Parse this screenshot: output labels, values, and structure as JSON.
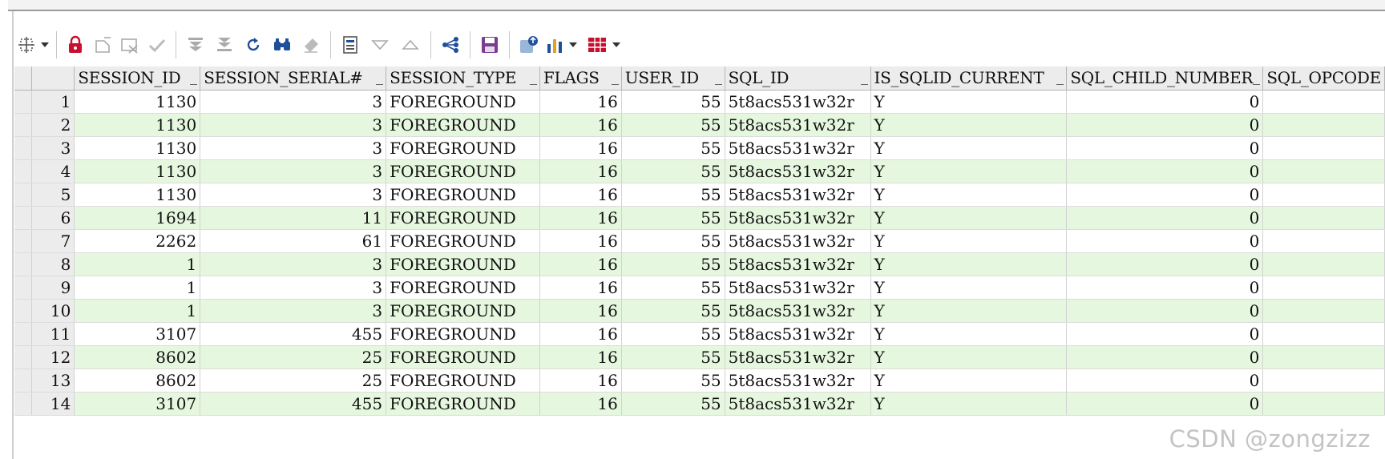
{
  "toolbar": {
    "icons": [
      "grid-options-icon",
      "dropdown-arrow-icon",
      "lock-icon",
      "insert-record-icon",
      "delete-record-icon",
      "post-changes-icon",
      "first-record-icon",
      "last-record-icon",
      "refresh-icon",
      "find-icon",
      "clear-icon",
      "single-record-view-icon",
      "sort-desc-icon",
      "sort-asc-icon",
      "query-by-example-icon",
      "save-icon",
      "export-icon",
      "chart-icon",
      "dropdown-arrow-icon",
      "table-view-icon",
      "dropdown-arrow-icon"
    ]
  },
  "grid": {
    "columns": [
      "SESSION_ID",
      "SESSION_SERIAL#",
      "SESSION_TYPE",
      "FLAGS",
      "USER_ID",
      "SQL_ID",
      "IS_SQLID_CURRENT",
      "SQL_CHILD_NUMBER",
      "SQL_OPCODE"
    ],
    "rows": [
      {
        "n": "1",
        "session_id": "1130",
        "serial": "3",
        "type": "FOREGROUND",
        "flags": "16",
        "user_id": "55",
        "sql_id": "5t8acs531w32r",
        "current": "Y",
        "child": "0",
        "opcode": ""
      },
      {
        "n": "2",
        "session_id": "1130",
        "serial": "3",
        "type": "FOREGROUND",
        "flags": "16",
        "user_id": "55",
        "sql_id": "5t8acs531w32r",
        "current": "Y",
        "child": "0",
        "opcode": ""
      },
      {
        "n": "3",
        "session_id": "1130",
        "serial": "3",
        "type": "FOREGROUND",
        "flags": "16",
        "user_id": "55",
        "sql_id": "5t8acs531w32r",
        "current": "Y",
        "child": "0",
        "opcode": ""
      },
      {
        "n": "4",
        "session_id": "1130",
        "serial": "3",
        "type": "FOREGROUND",
        "flags": "16",
        "user_id": "55",
        "sql_id": "5t8acs531w32r",
        "current": "Y",
        "child": "0",
        "opcode": ""
      },
      {
        "n": "5",
        "session_id": "1130",
        "serial": "3",
        "type": "FOREGROUND",
        "flags": "16",
        "user_id": "55",
        "sql_id": "5t8acs531w32r",
        "current": "Y",
        "child": "0",
        "opcode": ""
      },
      {
        "n": "6",
        "session_id": "1694",
        "serial": "11",
        "type": "FOREGROUND",
        "flags": "16",
        "user_id": "55",
        "sql_id": "5t8acs531w32r",
        "current": "Y",
        "child": "0",
        "opcode": ""
      },
      {
        "n": "7",
        "session_id": "2262",
        "serial": "61",
        "type": "FOREGROUND",
        "flags": "16",
        "user_id": "55",
        "sql_id": "5t8acs531w32r",
        "current": "Y",
        "child": "0",
        "opcode": ""
      },
      {
        "n": "8",
        "session_id": "1",
        "serial": "3",
        "type": "FOREGROUND",
        "flags": "16",
        "user_id": "55",
        "sql_id": "5t8acs531w32r",
        "current": "Y",
        "child": "0",
        "opcode": ""
      },
      {
        "n": "9",
        "session_id": "1",
        "serial": "3",
        "type": "FOREGROUND",
        "flags": "16",
        "user_id": "55",
        "sql_id": "5t8acs531w32r",
        "current": "Y",
        "child": "0",
        "opcode": ""
      },
      {
        "n": "10",
        "session_id": "1",
        "serial": "3",
        "type": "FOREGROUND",
        "flags": "16",
        "user_id": "55",
        "sql_id": "5t8acs531w32r",
        "current": "Y",
        "child": "0",
        "opcode": ""
      },
      {
        "n": "11",
        "session_id": "3107",
        "serial": "455",
        "type": "FOREGROUND",
        "flags": "16",
        "user_id": "55",
        "sql_id": "5t8acs531w32r",
        "current": "Y",
        "child": "0",
        "opcode": ""
      },
      {
        "n": "12",
        "session_id": "8602",
        "serial": "25",
        "type": "FOREGROUND",
        "flags": "16",
        "user_id": "55",
        "sql_id": "5t8acs531w32r",
        "current": "Y",
        "child": "0",
        "opcode": ""
      },
      {
        "n": "13",
        "session_id": "8602",
        "serial": "25",
        "type": "FOREGROUND",
        "flags": "16",
        "user_id": "55",
        "sql_id": "5t8acs531w32r",
        "current": "Y",
        "child": "0",
        "opcode": ""
      },
      {
        "n": "14",
        "session_id": "3107",
        "serial": "455",
        "type": "FOREGROUND",
        "flags": "16",
        "user_id": "55",
        "sql_id": "5t8acs531w32r",
        "current": "Y",
        "child": "0",
        "opcode": ""
      }
    ]
  },
  "colors": {
    "alt_row": "#e6f7df",
    "header_bg": "#ececec",
    "lock_red": "#c8102e",
    "save_purple": "#7a3d8f"
  },
  "watermark": "CSDN @zongzizz"
}
